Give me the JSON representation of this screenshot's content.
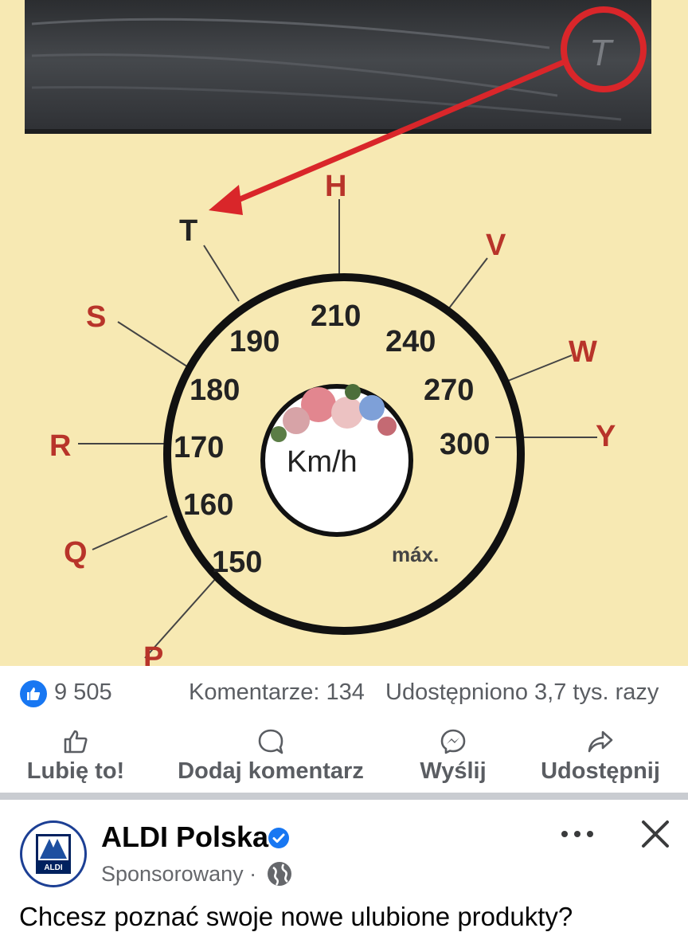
{
  "image": {
    "letters": [
      "P",
      "Q",
      "R",
      "S",
      "T",
      "H",
      "V",
      "W",
      "Y"
    ],
    "speeds": [
      "150",
      "160",
      "170",
      "180",
      "190",
      "210",
      "240",
      "270",
      "300"
    ],
    "center_label": "Km/h",
    "max_label": "máx."
  },
  "stats": {
    "likes": "9 505",
    "comments": "Komentarze: 134",
    "shares": "Udostępniono 3,7 tys. razy"
  },
  "actions": {
    "like": "Lubię to!",
    "comment": "Dodaj komentarz",
    "send": "Wyślij",
    "share": "Udostępnij"
  },
  "next_post": {
    "page_name": "ALDI Polska",
    "sponsored": "Sponsorowany ·",
    "text": "Chcesz poznać swoje nowe ulubione produkty?",
    "logo_text": "ALDI"
  },
  "colors": {
    "facebook_blue": "#1877f2",
    "arrow_red": "#d9262a",
    "letter_red": "#b8342a",
    "image_background": "#f7e9b3"
  }
}
